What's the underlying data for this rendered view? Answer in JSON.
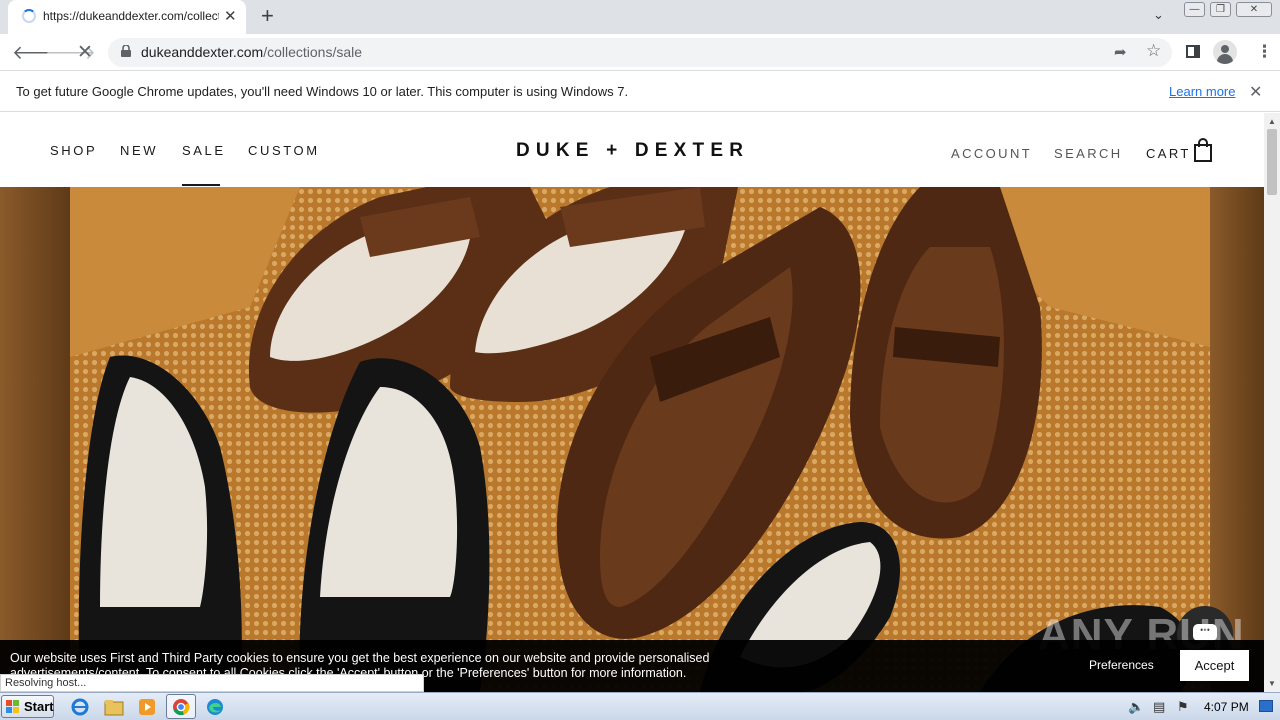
{
  "browser": {
    "tab_title": "https://dukeanddexter.com/collecti",
    "tab_close": "✕",
    "new_tab": "+",
    "url_domain": "dukeanddexter.com",
    "url_path": "/collections/sale",
    "infobar_text": "To get future Google Chrome updates, you'll need Windows 10 or later. This computer is using Windows 7.",
    "infobar_link": "Learn more",
    "status": "Resolving host..."
  },
  "site": {
    "nav": [
      "SHOP",
      "NEW",
      "SALE",
      "CUSTOM"
    ],
    "logo": "DUKE + DEXTER",
    "account": "ACCOUNT",
    "search": "SEARCH",
    "cart": "CART"
  },
  "cookie": {
    "text": "Our website uses First and Third Party cookies to ensure you get the best experience on our website and provide personalised advertisements/content. To consent to all Cookies click the 'Accept' button or the 'Preferences' button for more information.",
    "preferences": "Preferences",
    "accept": "Accept"
  },
  "watermark": "ANY RUN",
  "taskbar": {
    "start": "Start",
    "clock": "4:07 PM"
  },
  "icons": {
    "tab_loading": "spinner-icon",
    "back": "back-arrow-icon",
    "forward": "forward-arrow-icon",
    "stop": "stop-loading-icon",
    "lock": "lock-icon",
    "share": "share-icon",
    "bookmark": "star-icon",
    "side_panel": "side-panel-icon",
    "profile": "profile-icon",
    "menu": "kebab-menu-icon",
    "bag": "shopping-bag-icon",
    "chat": "chat-icon"
  },
  "colors": {
    "chrome_tabstrip": "#dee1e6",
    "link_blue": "#1a73e8",
    "hero_orange": "#b8792e",
    "cookie_bg": "#000000",
    "brown_leather": "#5a2f16"
  }
}
